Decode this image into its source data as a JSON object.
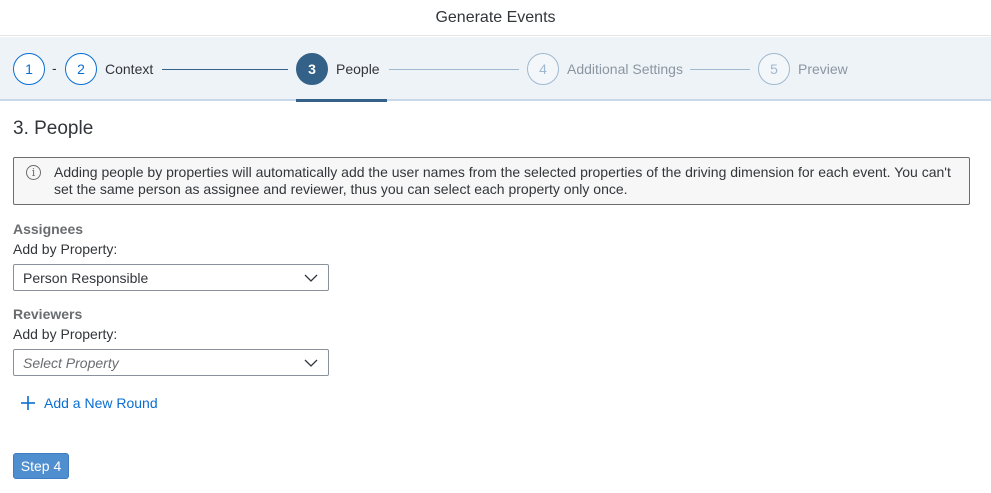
{
  "header": {
    "title": "Generate Events"
  },
  "wizard": {
    "steps": [
      {
        "number": "1",
        "label": ""
      },
      {
        "number": "2",
        "label": "Context"
      },
      {
        "number": "3",
        "label": "People"
      },
      {
        "number": "4",
        "label": "Additional Settings"
      },
      {
        "number": "5",
        "label": "Preview"
      }
    ],
    "separator": "-"
  },
  "page": {
    "title": "3. People",
    "info": "Adding people by properties will automatically add the user names from the selected properties of the driving dimension for each event. You can't set the same person as assignee and reviewer, thus you can select each property only once."
  },
  "assignees": {
    "heading": "Assignees",
    "label": "Add by Property:",
    "value": "Person Responsible"
  },
  "reviewers": {
    "heading": "Reviewers",
    "label": "Add by Property:",
    "placeholder": "Select Property"
  },
  "actions": {
    "add_round": "Add a New Round",
    "next_step": "Step 4"
  },
  "colors": {
    "accent": "#0a6ed1",
    "active_step": "#346187",
    "button": "#4f8fcf"
  }
}
